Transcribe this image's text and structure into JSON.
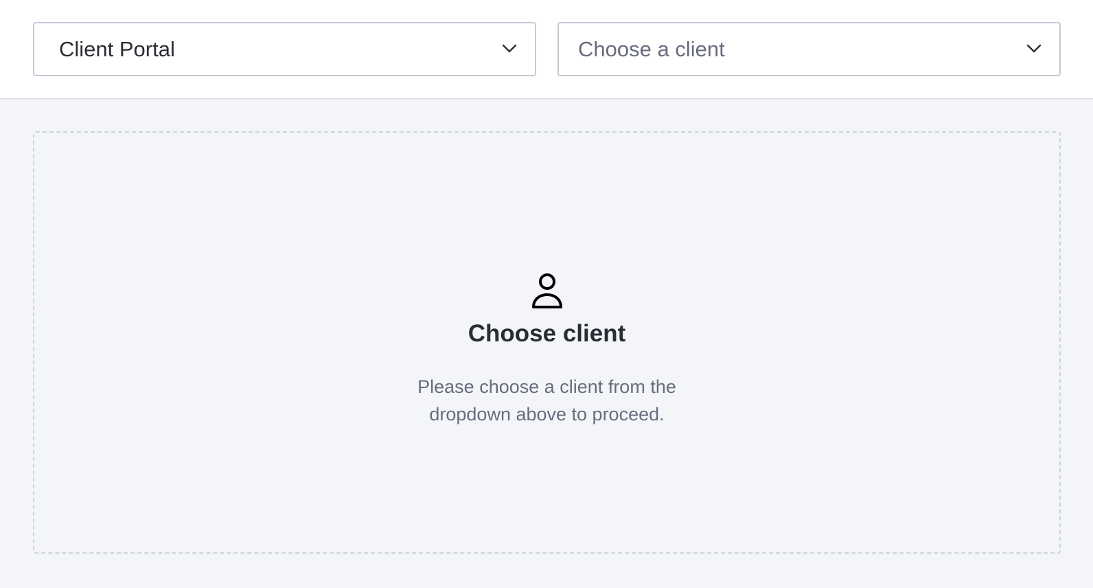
{
  "header": {
    "app_select": {
      "value": "Client Portal"
    },
    "client_select": {
      "placeholder": "Choose a client"
    }
  },
  "empty_state": {
    "icon": "person-icon",
    "title": "Choose client",
    "message": "Please choose a client from the dropdown above to proceed."
  },
  "colors": {
    "background": "#f4f5f9",
    "header_background": "#ffffff",
    "text_primary": "#2a2d34",
    "text_secondary": "#696c7d",
    "border": "#c6c8d6"
  }
}
